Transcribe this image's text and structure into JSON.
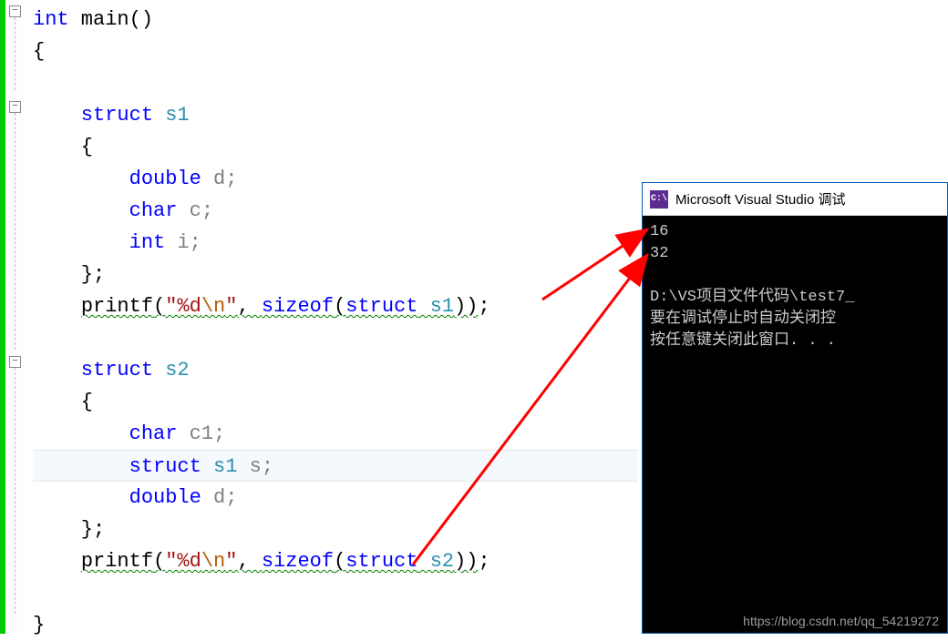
{
  "code": {
    "line1_kw": "int",
    "line1_main": " main",
    "line1_paren": "()",
    "line2": "{",
    "line4_kw": "    struct",
    "line4_type": " s1",
    "line5": "    {",
    "line6_kw": "        double",
    "line6_decl": " d;",
    "line7_kw": "        char",
    "line7_decl": " c;",
    "line8_kw": "        int",
    "line8_decl": " i;",
    "line9": "    };",
    "line10_pre": "    ",
    "line10_printf": "printf",
    "line10_open": "(",
    "line10_str1": "\"%d",
    "line10_esc": "\\n",
    "line10_str2": "\"",
    "line10_comma": ", ",
    "line10_sizeof": "sizeof",
    "line10_open2": "(",
    "line10_struct": "struct",
    "line10_type": " s1",
    "line10_close": "))",
    "line10_semi": ";",
    "line12_kw": "    struct",
    "line12_type": " s2",
    "line13": "    {",
    "line14_kw": "        char",
    "line14_decl": " c1;",
    "line15_kw": "        struct",
    "line15_type": " s1",
    "line15_decl": " s;",
    "line16_kw": "        double",
    "line16_decl": " d;",
    "line17": "    };",
    "line18_pre": "    ",
    "line18_printf": "printf",
    "line18_open": "(",
    "line18_str1": "\"%d",
    "line18_esc": "\\n",
    "line18_str2": "\"",
    "line18_comma": ", ",
    "line18_sizeof": "sizeof",
    "line18_open2": "(",
    "line18_struct": "struct",
    "line18_type": " s2",
    "line18_close": "))",
    "line18_semi": ";",
    "line20": "}"
  },
  "console": {
    "title": "Microsoft Visual Studio 调试",
    "icon": "C:\\",
    "output1": "16",
    "output2": "32",
    "path": "D:\\VS项目文件代码\\test7_",
    "msg1": "要在调试停止时自动关闭控",
    "msg2": "按任意键关闭此窗口. . ."
  },
  "watermark": "https://blog.csdn.net/qq_54219272"
}
